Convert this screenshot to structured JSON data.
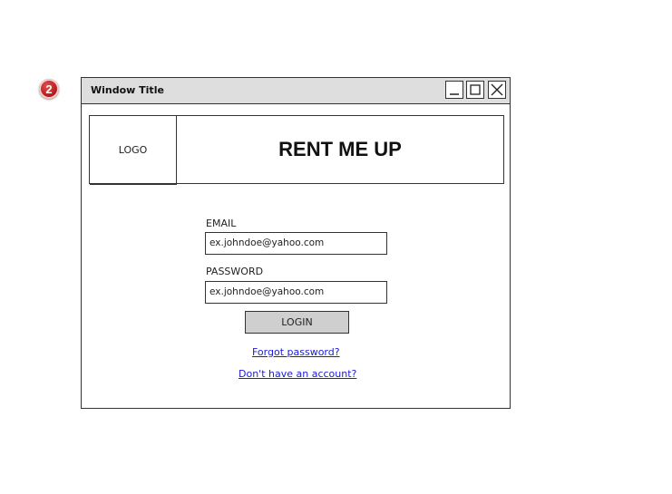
{
  "annotation": {
    "number": "2"
  },
  "window": {
    "title": "Window Title"
  },
  "header": {
    "logo": "LOGO",
    "brand": "RENT ME UP"
  },
  "form": {
    "email_label": "EMAIL",
    "email_value": "ex.johndoe@yahoo.com",
    "password_label": "PASSWORD",
    "password_value": "ex.johndoe@yahoo.com",
    "login_label": "LOGIN"
  },
  "links": {
    "forgot": "Forgot password?",
    "signup": "Don't have an account?"
  },
  "colors": {
    "titlebar": "#dedede",
    "button": "#cfcfcf",
    "link": "#1a1adb",
    "badge": "#b81818"
  },
  "icons": [
    "minimize-icon",
    "maximize-icon",
    "close-icon"
  ]
}
